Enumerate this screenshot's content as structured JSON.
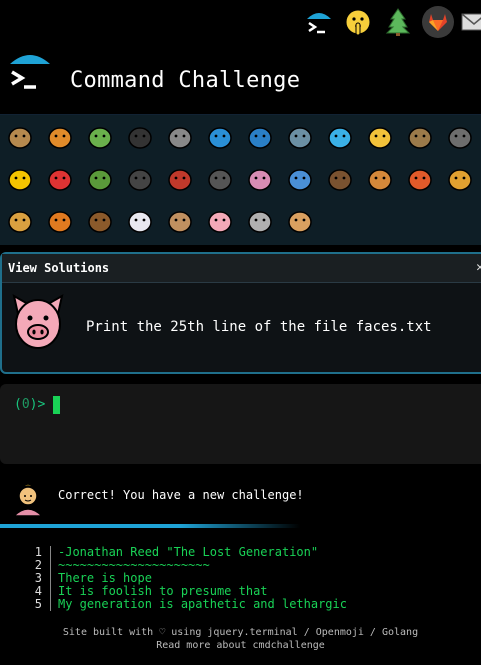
{
  "top_icons": [
    "terminal-prompt-icon",
    "shushing-face-icon",
    "tree-icon",
    "gitlab-icon",
    "mail-icon"
  ],
  "header": {
    "title": "Command Challenge"
  },
  "grid_icons": [
    "snail-icon",
    "butterfly-icon",
    "caterpillar-icon",
    "ant-icon",
    "spider-web-icon",
    "whale-icon",
    "dolphin-icon",
    "shark-icon",
    "fish-icon",
    "tropical-fish-icon",
    "blowfish-icon",
    "wolf-icon",
    "bee-icon",
    "ladybug-icon",
    "cricket-icon",
    "spider-icon",
    "scorpion-icon",
    "fly-icon",
    "worm-icon",
    "microbe-icon",
    "monkey-icon",
    "dog-icon",
    "fox-icon",
    "cat-icon",
    "lion-icon",
    "tiger-icon",
    "horse-icon",
    "unicorn-icon",
    "cow-icon",
    "pig-icon",
    "mouse-icon",
    "hamster-icon"
  ],
  "solutions": {
    "header": "View Solutions",
    "close": "✕",
    "challenge": "Print the 25th line of the file faces.txt"
  },
  "terminal": {
    "prompt_open": "(",
    "prompt_num": "0",
    "prompt_close": ")>"
  },
  "result": {
    "message": "Correct! You have a new challenge!"
  },
  "listing": [
    {
      "n": "1",
      "text": "-Jonathan Reed \"The Lost Generation\""
    },
    {
      "n": "2",
      "text": "~~~~~~~~~~~~~~~~~~~~~"
    },
    {
      "n": "3",
      "text": "There is hope"
    },
    {
      "n": "4",
      "text": "It is foolish to presume that"
    },
    {
      "n": "5",
      "text": "My generation is apathetic and lethargic"
    }
  ],
  "footer": {
    "line1": "Site built with ♡ using jquery.terminal / Openmoji / Golang",
    "line2": "Read more about cmdchallenge"
  },
  "colors": {
    "accent": "#1f6f8b",
    "prompt": "#19c37d",
    "cursor": "#19d256",
    "bluebar": "#1fa3d6"
  }
}
